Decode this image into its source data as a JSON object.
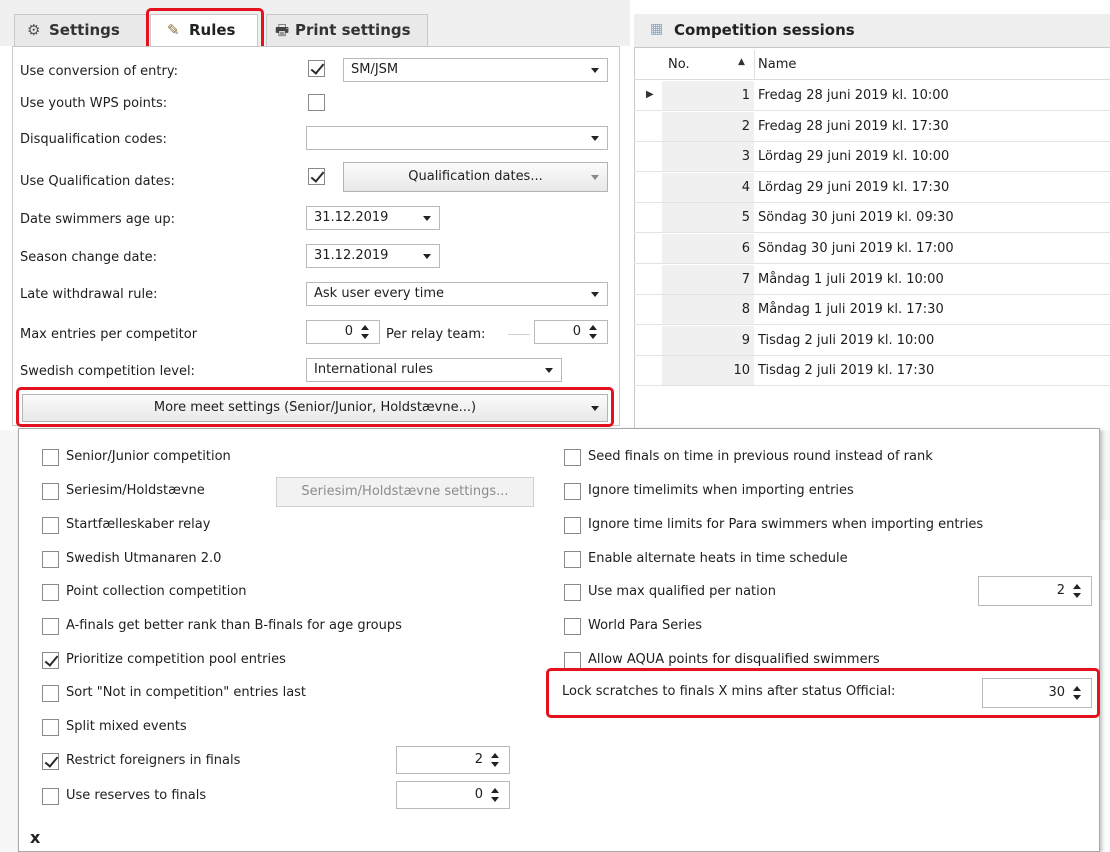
{
  "tabs": {
    "settings": "Settings",
    "rules": "Rules",
    "print_settings": "Print settings"
  },
  "rules": {
    "use_conversion": {
      "label": "Use conversion of entry:",
      "checked": true,
      "value": "SM/JSM"
    },
    "youth_wps": {
      "label": "Use youth WPS points:",
      "checked": false
    },
    "dq_codes": {
      "label": "Disqualification codes:",
      "value": ""
    },
    "qual_dates": {
      "label": "Use Qualification dates:",
      "checked": true,
      "button": "Qualification dates..."
    },
    "age_up": {
      "label": "Date swimmers age up:",
      "value": "31.12.2019"
    },
    "season_change": {
      "label": "Season change date:",
      "value": "31.12.2019"
    },
    "late_withdrawal": {
      "label": "Late withdrawal rule:",
      "value": "Ask user every time"
    },
    "max_entries": {
      "label": "Max entries per competitor",
      "value": "0",
      "relay_label": "Per relay team:",
      "relay_value": "0"
    },
    "swedish_level": {
      "label": "Swedish competition level:",
      "value": "International rules"
    },
    "more_button": "More meet settings (Senior/Junior, Holdstævne...)"
  },
  "sessions": {
    "title": "Competition sessions",
    "columns": {
      "no": "No.",
      "name": "Name"
    },
    "rows": [
      {
        "no": "1",
        "name": "Fredag 28 juni 2019 kl. 10:00"
      },
      {
        "no": "2",
        "name": "Fredag 28 juni 2019 kl. 17:30"
      },
      {
        "no": "3",
        "name": "Lördag 29 juni 2019 kl. 10:00"
      },
      {
        "no": "4",
        "name": "Lördag 29 juni 2019 kl. 17:30"
      },
      {
        "no": "5",
        "name": "Söndag 30 juni 2019 kl. 09:30"
      },
      {
        "no": "6",
        "name": "Söndag 30 juni 2019 kl. 17:00"
      },
      {
        "no": "7",
        "name": "Måndag 1 juli 2019 kl. 10:00"
      },
      {
        "no": "8",
        "name": "Måndag 1 juli 2019 kl. 17:30"
      },
      {
        "no": "9",
        "name": "Tisdag 2 juli 2019 kl. 10:00"
      },
      {
        "no": "10",
        "name": "Tisdag 2 juli 2019 kl. 17:30"
      }
    ]
  },
  "popup": {
    "left": [
      {
        "label": "Senior/Junior competition",
        "checked": false
      },
      {
        "label": "Seriesim/Holdstævne",
        "checked": false
      },
      {
        "label": "Startfælleskaber relay",
        "checked": false
      },
      {
        "label": "Swedish Utmanaren 2.0",
        "checked": false
      },
      {
        "label": "Point collection competition",
        "checked": false
      },
      {
        "label": "A-finals get better rank than B-finals for age groups",
        "checked": false
      },
      {
        "label": "Prioritize competition pool entries",
        "checked": true
      },
      {
        "label": "Sort \"Not in competition\" entries last",
        "checked": false
      },
      {
        "label": "Split mixed events",
        "checked": false
      },
      {
        "label": "Restrict foreigners in finals",
        "checked": true,
        "value": "2"
      },
      {
        "label": "Use reserves to finals",
        "checked": false,
        "value": "0"
      }
    ],
    "seriesim_button": "Seriesim/Holdstævne settings...",
    "right": [
      {
        "label": "Seed finals on time in previous round instead of rank",
        "checked": false
      },
      {
        "label": "Ignore timelimits when importing entries",
        "checked": false
      },
      {
        "label": "Ignore time limits for Para swimmers when importing entries",
        "checked": false
      },
      {
        "label": "Enable alternate heats in time schedule",
        "checked": false
      },
      {
        "label": "Use max qualified per nation",
        "checked": false,
        "value": "2"
      },
      {
        "label": "World Para Series",
        "checked": false
      },
      {
        "label": "Allow AQUA points for disqualified swimmers",
        "checked": false
      }
    ],
    "lock_scratches": {
      "label": "Lock scratches to finals X mins after status Official:",
      "value": "30"
    },
    "close": "x"
  },
  "colors": {
    "highlight": "#e3121c",
    "panel": "#ffffff",
    "header": "#eeeeee"
  }
}
